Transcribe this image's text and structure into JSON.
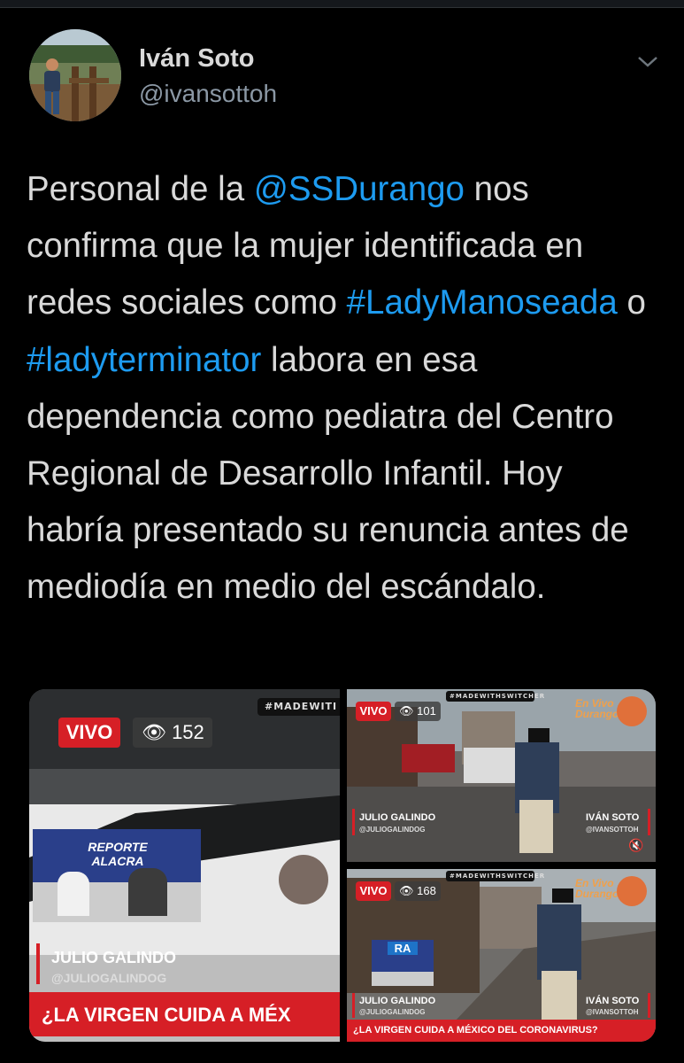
{
  "author": {
    "name": "Iván Soto",
    "handle": "@ivansottoh",
    "menu_icon": "chevron-down-icon"
  },
  "tweet": {
    "part1": "Personal de la ",
    "mention": "@SSDurango",
    "part2": " nos confirma que la mujer identificada en redes sociales como ",
    "hashtag1": "#LadyManoseada",
    "part3": " o ",
    "hashtag2": "#ladyterminator",
    "part4": " labora en esa dependencia como pediatra del Centro Regional de Desarrollo Infantil. Hoy habría presentado su renuncia antes de mediodía en medio del escándalo."
  },
  "media": {
    "main": {
      "live": "VIVO",
      "views": "152",
      "watermark": "#MADEWITI",
      "studio_logo": "REPORTE ALACRA",
      "presenter": "JULIO GALINDO",
      "presenter_handle": "@JULIOGALINDOG",
      "headline": "¿LA VIRGEN CUIDA A MÉX"
    },
    "top_right": {
      "live": "VIVO",
      "views": "101",
      "watermark": "#MADEWITHSWITCHER",
      "left_name": "JULIO GALINDO",
      "left_handle": "@JULIOGALINDOG",
      "right_name": "IVÁN SOTO",
      "right_handle": "@IVANSOTTOH",
      "corner_text": "En Vivo Durango"
    },
    "bottom_right": {
      "live": "VIVO",
      "views": "168",
      "watermark": "#MADEWITHSWITCHER",
      "left_name": "JULIO GALINDO",
      "left_handle": "@JULIOGALINDOG",
      "right_name": "IVÁN SOTO",
      "right_handle": "@IVANSOTTOH",
      "corner_text": "En Vivo Durango",
      "headline": "¿LA VIRGEN CUIDA A MÉXICO DEL CORONAVIRUS?",
      "studio_logo": "RA"
    }
  },
  "colors": {
    "background": "#000000",
    "text": "#d9d9d9",
    "muted": "#8b98a5",
    "link": "#1d9bf0",
    "live_red": "#d61f26"
  }
}
